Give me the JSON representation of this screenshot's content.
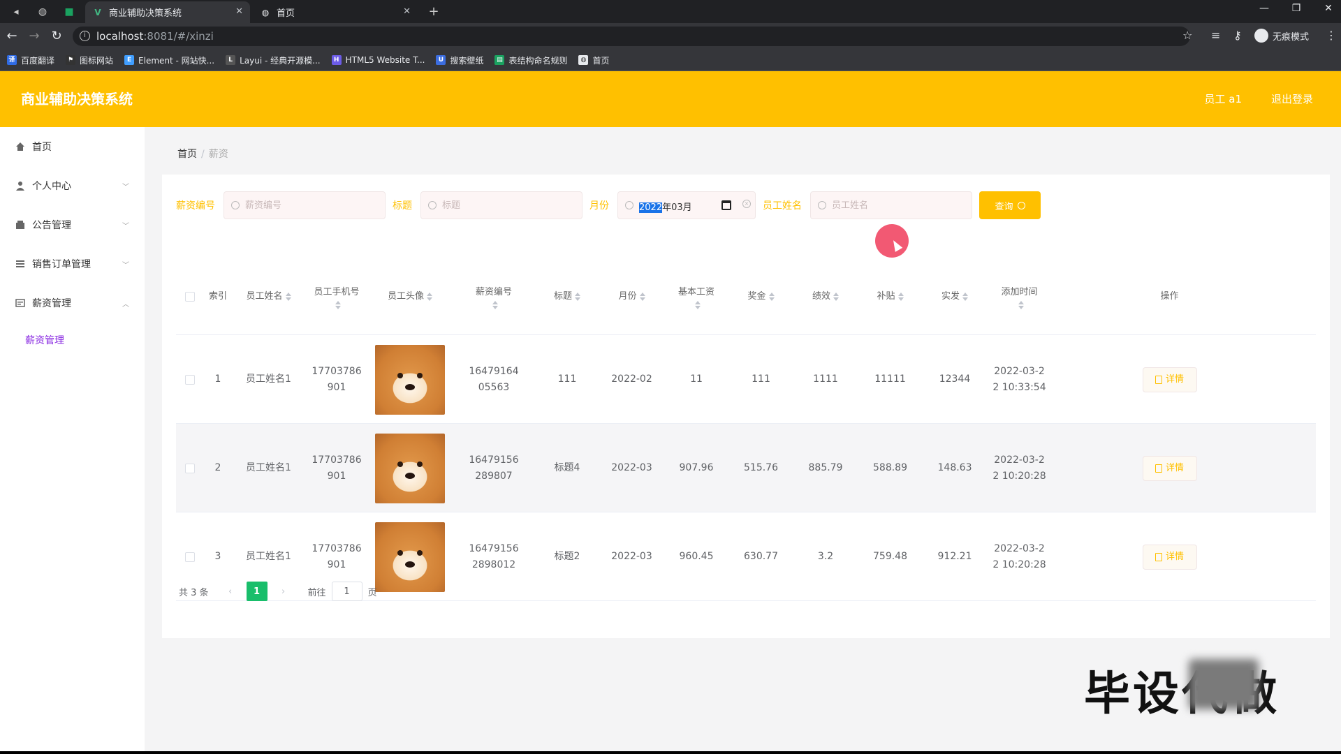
{
  "browser": {
    "tabs": [
      {
        "title": "商业辅助决策系统",
        "active": true
      },
      {
        "title": "首页",
        "active": false
      }
    ],
    "url_host": "localhost",
    "url_path": ":8081/#/xinzi",
    "incognito_label": "无痕模式",
    "bookmarks": [
      {
        "label": "百度翻译",
        "color": "#2f6be5"
      },
      {
        "label": "图标网站",
        "color": "#333333"
      },
      {
        "label": "Element - 网站快...",
        "color": "#409eff"
      },
      {
        "label": "Layui - 经典开源模...",
        "color": "#555555"
      },
      {
        "label": "HTML5 Website T...",
        "color": "#6c5ce7"
      },
      {
        "label": "搜索壁纸",
        "color": "#3b6de0"
      },
      {
        "label": "表结构命名规则",
        "color": "#1aa260"
      },
      {
        "label": "首页",
        "color": "#e8eaed"
      }
    ]
  },
  "header": {
    "brand": "商业辅助决策系统",
    "user": "员工 a1",
    "logout": "退出登录",
    "color": "#ffc000"
  },
  "sidebar": {
    "items": [
      {
        "label": "首页",
        "icon": "home-icon"
      },
      {
        "label": "个人中心",
        "icon": "user-icon"
      },
      {
        "label": "公告管理",
        "icon": "notice-icon"
      },
      {
        "label": "销售订单管理",
        "icon": "list-icon"
      },
      {
        "label": "薪资管理",
        "icon": "salary-icon"
      }
    ],
    "sub_item": "薪资管理"
  },
  "breadcrumb": {
    "home": "首页",
    "sep": "/",
    "current": "薪资"
  },
  "search": {
    "salary_no_label": "薪资编号",
    "salary_no_placeholder": "薪资编号",
    "title_label": "标题",
    "title_placeholder": "标题",
    "month_label": "月份",
    "month_year_selected": "2022",
    "month_rest": "年03月",
    "name_label": "员工姓名",
    "name_placeholder": "员工姓名",
    "button": "查询"
  },
  "table": {
    "headers": {
      "index": "索引",
      "name": "员工姓名",
      "phone": "员工手机号",
      "avatar": "员工头像",
      "salary_no": "薪资编号",
      "title": "标题",
      "month": "月份",
      "base": "基本工资",
      "bonus": "奖金",
      "perf": "绩效",
      "subsidy": "补贴",
      "actual": "实发",
      "time": "添加时间",
      "ops": "操作"
    },
    "rows": [
      {
        "index": "1",
        "name": "员工姓名1",
        "phone_a": "17703786",
        "phone_b": "901",
        "no_a": "16479164",
        "no_b": "05563",
        "title": "111",
        "month": "2022-02",
        "base": "11",
        "bonus": "111",
        "perf": "1111",
        "subsidy": "11111",
        "actual": "12344",
        "time_a": "2022-03-2",
        "time_b": "2 10:33:54",
        "op": "详情"
      },
      {
        "index": "2",
        "name": "员工姓名1",
        "phone_a": "17703786",
        "phone_b": "901",
        "no_a": "16479156",
        "no_b": "289807",
        "title": "标题4",
        "month": "2022-03",
        "base": "907.96",
        "bonus": "515.76",
        "perf": "885.79",
        "subsidy": "588.89",
        "actual": "148.63",
        "time_a": "2022-03-2",
        "time_b": "2 10:20:28",
        "op": "详情"
      },
      {
        "index": "3",
        "name": "员工姓名1",
        "phone_a": "17703786",
        "phone_b": "901",
        "no_a": "16479156",
        "no_b": "2898012",
        "title": "标题2",
        "month": "2022-03",
        "base": "960.45",
        "bonus": "630.77",
        "perf": "3.2",
        "subsidy": "759.48",
        "actual": "912.21",
        "time_a": "2022-03-2",
        "time_b": "2 10:20:28",
        "op": "详情"
      }
    ]
  },
  "pager": {
    "total": "共 3 条",
    "current": "1",
    "goto": "前往",
    "goto_value": "1",
    "page_unit": "页"
  },
  "watermark": "毕设代做"
}
